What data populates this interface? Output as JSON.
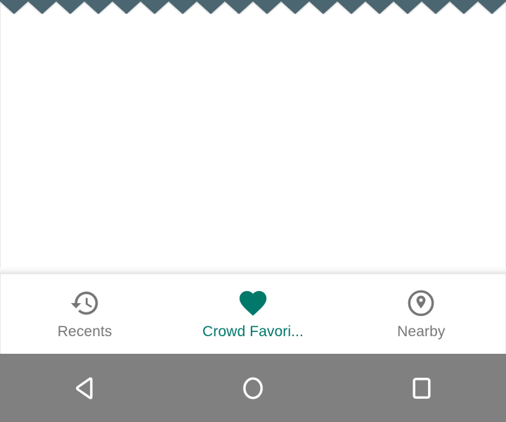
{
  "app": {
    "background_color": "#ffffff",
    "content_area": {
      "name": "empty-content-area",
      "text": ""
    }
  },
  "decoration": {
    "zigzag": {
      "icon": "zigzag-torn-edge",
      "color": "#4c6571",
      "tooth_width": 40,
      "tooth_depth": 18,
      "tooth_count": 18
    }
  },
  "bottom_nav": {
    "active_color": "#00796b",
    "inactive_color": "#777777",
    "tabs": [
      {
        "id": "recents",
        "label": "Recents",
        "icon": "history-clock-icon",
        "active": false
      },
      {
        "id": "crowd-favorites",
        "label": "Crowd Favori...",
        "icon": "heart-filled-icon",
        "active": true
      },
      {
        "id": "nearby",
        "label": "Nearby",
        "icon": "location-pin-circle-icon",
        "active": false
      }
    ]
  },
  "system_nav": {
    "background_color": "#808080",
    "icon_color": "#ffffff",
    "buttons": [
      {
        "id": "back",
        "icon": "back-triangle-icon",
        "label": "Back"
      },
      {
        "id": "home",
        "icon": "home-circle-icon",
        "label": "Home"
      },
      {
        "id": "overview",
        "icon": "overview-square-icon",
        "label": "Overview"
      }
    ]
  }
}
